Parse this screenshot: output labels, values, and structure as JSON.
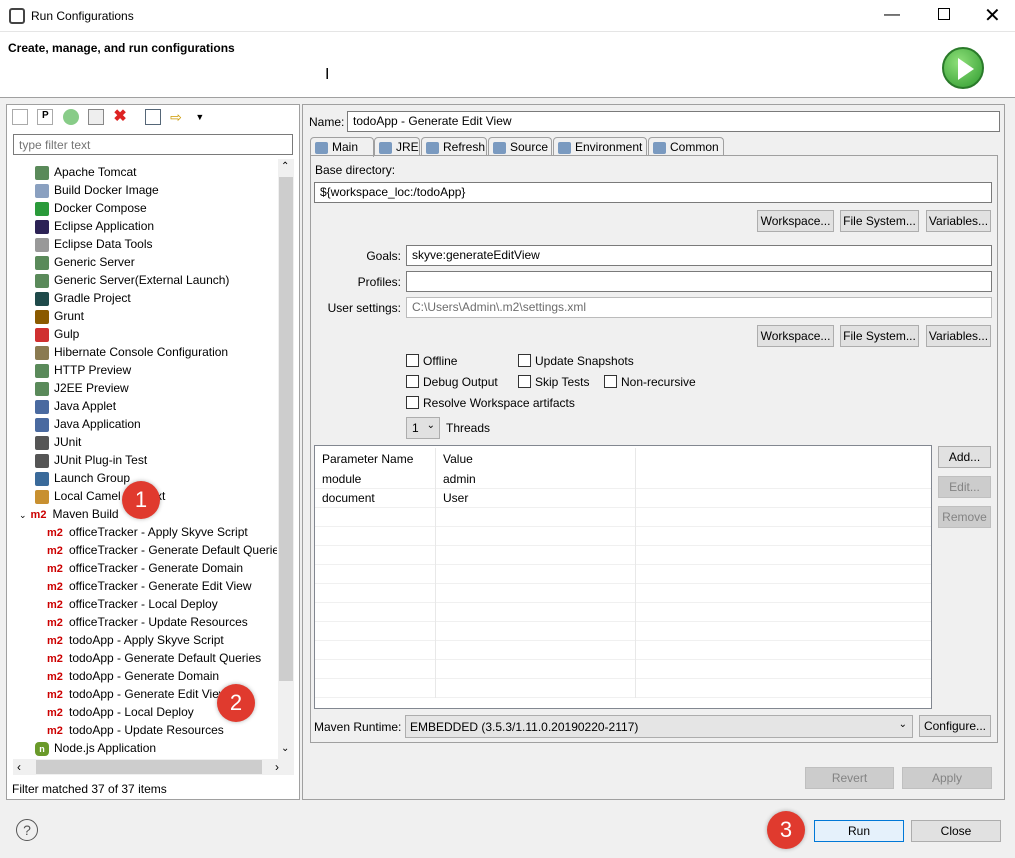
{
  "window": {
    "title": "Run Configurations",
    "header_title": "Create, manage, and run configurations"
  },
  "colors": {
    "badge": "#e03a2e",
    "selection": "#d9d9d9",
    "maven": "#cc0000"
  },
  "left": {
    "filter_placeholder": "type filter text",
    "status": "Filter matched 37 of 37 items",
    "toolbar": [
      "new-config-icon",
      "new-prototype-icon",
      "export-icon",
      "duplicate-icon",
      "delete-icon",
      "collapse-all-icon",
      "filter-icon"
    ],
    "items": [
      {
        "label": "Apache Tomcat",
        "icon": "server-icon",
        "color": "#5a8a5a"
      },
      {
        "label": "Build Docker Image",
        "icon": "docker-build-icon",
        "color": "#8aa0c0"
      },
      {
        "label": "Docker Compose",
        "icon": "play-icon",
        "color": "#2a9a3a"
      },
      {
        "label": "Eclipse Application",
        "icon": "eclipse-icon",
        "color": "#2c2255"
      },
      {
        "label": "Eclipse Data Tools",
        "icon": "database-icon",
        "color": "#999999"
      },
      {
        "label": "Generic Server",
        "icon": "server-icon",
        "color": "#5a8a5a"
      },
      {
        "label": "Generic Server(External Launch)",
        "icon": "server-icon",
        "color": "#5a8a5a"
      },
      {
        "label": "Gradle Project",
        "icon": "gradle-icon",
        "color": "#1f4a4a"
      },
      {
        "label": "Grunt",
        "icon": "grunt-icon",
        "color": "#8a5a00"
      },
      {
        "label": "Gulp",
        "icon": "gulp-icon",
        "color": "#d03030"
      },
      {
        "label": "Hibernate Console Configuration",
        "icon": "hibernate-icon",
        "color": "#8a7a50"
      },
      {
        "label": "HTTP Preview",
        "icon": "server-icon",
        "color": "#5a8a5a"
      },
      {
        "label": "J2EE Preview",
        "icon": "server-icon",
        "color": "#5a8a5a"
      },
      {
        "label": "Java Applet",
        "icon": "applet-icon",
        "color": "#4a6aa0"
      },
      {
        "label": "Java Application",
        "icon": "java-icon",
        "color": "#4a6aa0"
      },
      {
        "label": "JUnit",
        "icon": "junit-icon",
        "color": "#555555"
      },
      {
        "label": "JUnit Plug-in Test",
        "icon": "junit-icon",
        "color": "#555555"
      },
      {
        "label": "Launch Group",
        "icon": "launch-group-icon",
        "color": "#3a6a9a"
      },
      {
        "label": "Local Camel Context",
        "icon": "camel-icon",
        "color": "#c89030"
      }
    ],
    "maven": {
      "label": "Maven Build",
      "children": [
        "officeTracker - Apply Skyve Script",
        "officeTracker - Generate Default Queries",
        "officeTracker - Generate Domain",
        "officeTracker - Generate Edit View",
        "officeTracker - Local Deploy",
        "officeTracker - Update Resources",
        "todoApp - Apply Skyve Script",
        "todoApp - Generate Default Queries",
        "todoApp - Generate Domain",
        "todoApp - Generate Edit View",
        "todoApp - Local Deploy",
        "todoApp - Update Resources"
      ],
      "selected_index": 9
    },
    "after": [
      {
        "label": "Node.js Application",
        "icon": "nodejs-icon",
        "color": "#6a9a2a"
      }
    ]
  },
  "right": {
    "name_label": "Name:",
    "name_value": "todoApp - Generate Edit View",
    "tabs": [
      {
        "label": "Main",
        "icon": "main-tab-icon"
      },
      {
        "label": "JRE",
        "icon": "jre-icon"
      },
      {
        "label": "Refresh",
        "icon": "refresh-icon"
      },
      {
        "label": "Source",
        "icon": "source-icon"
      },
      {
        "label": "Environment",
        "icon": "environment-icon"
      },
      {
        "label": "Common",
        "icon": "common-icon"
      }
    ],
    "active_tab": "Main",
    "base_dir_label": "Base directory:",
    "base_dir_value": "${workspace_loc:/todoApp}",
    "workspace": "Workspace...",
    "filesystem": "File System...",
    "variables": "Variables...",
    "goals_label": "Goals:",
    "goals_value": "skyve:generateEditView",
    "profiles_label": "Profiles:",
    "profiles_value": "",
    "settings_label": "User settings:",
    "settings_value": "C:\\Users\\Admin\\.m2\\settings.xml",
    "checks": {
      "offline": "Offline",
      "update_snapshots": "Update Snapshots",
      "debug": "Debug Output",
      "skip_tests": "Skip Tests",
      "non_recursive": "Non-recursive",
      "resolve": "Resolve Workspace artifacts"
    },
    "threads_value": "1",
    "threads_label": "Threads",
    "params": {
      "headers": [
        "Parameter Name",
        "Value"
      ],
      "rows": [
        [
          "module",
          "admin"
        ],
        [
          "document",
          "User"
        ]
      ]
    },
    "add": "Add...",
    "edit": "Edit...",
    "remove": "Remove",
    "runtime_label": "Maven Runtime:",
    "runtime_value": "EMBEDDED (3.5.3/1.11.0.20190220-2117)",
    "configure": "Configure...",
    "revert": "Revert",
    "apply": "Apply"
  },
  "footer": {
    "run": "Run",
    "close": "Close"
  },
  "badges": [
    "1",
    "2",
    "3"
  ]
}
